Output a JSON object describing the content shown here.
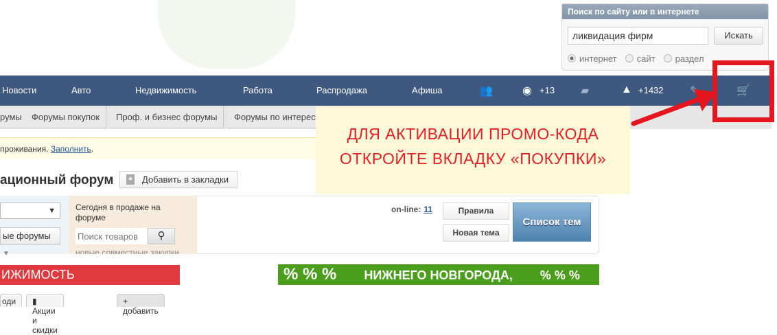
{
  "search": {
    "title": "Поиск по сайту или в интернете",
    "value": "ликвидация фирм",
    "button": "Искать",
    "options": [
      "интернет",
      "сайт",
      "раздел"
    ],
    "selected": "интернет"
  },
  "nav": {
    "items": [
      "Новости",
      "Авто",
      "Недвижимость",
      "Работа",
      "Распродажа",
      "Афиша"
    ],
    "views": "+13",
    "rating": "+1432"
  },
  "tabs": [
    "румы",
    "Форумы покупок",
    "Проф. и бизнес форумы",
    "Форумы по интерес"
  ],
  "notice": {
    "text": "проживания.",
    "link": "Заполнить"
  },
  "forum": {
    "title": "ационный форум",
    "bookmark": "Добавить в закладки",
    "select2": "ые форумы",
    "sale_text": "Сегодня в продаже на форуме",
    "sale_placeholder": "Поиск товаров",
    "sale_cut": "новые совместные закупки",
    "online_label": "on-line:",
    "online_count": "11",
    "rules": "Правила",
    "new_topic": "Новая тема",
    "topic_list": "Список тем"
  },
  "banners": {
    "red": "ИЖИМОСТЬ",
    "green": "НИЖНЕГО НОВГОРОДА,"
  },
  "bottom_tabs": [
    "оди",
    "Акции и скидки",
    "+ добавить"
  ],
  "callout": {
    "line1": "ДЛЯ АКТИВАЦИИ ПРОМО-КОДА",
    "line2": "ОТКРОЙТЕ ВКЛАДКУ «ПОКУПКИ»"
  },
  "colors": {
    "nav": "#3f587f",
    "annotation": "#e5161d"
  }
}
